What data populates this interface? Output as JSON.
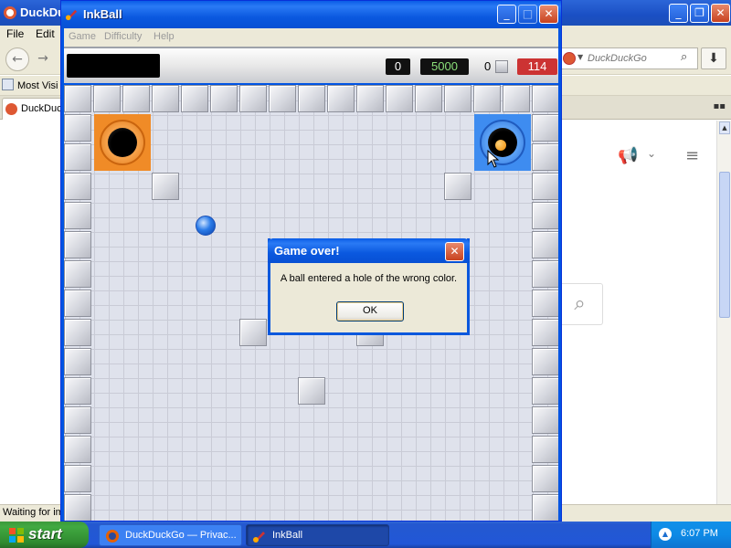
{
  "firefox": {
    "title": "DuckDuck",
    "menu": [
      "File",
      "Edit"
    ],
    "search_placeholder": "DuckDuckGo",
    "bookmarks_label": "Most Visi",
    "tab_label": "DuckDuck",
    "status": "Waiting for im"
  },
  "inkball": {
    "title": "InkBall",
    "menu": [
      "Game",
      "Difficulty",
      "Help"
    ],
    "ink_used": "0",
    "target_score": "5000",
    "balls_count": "0",
    "time_left": "114"
  },
  "dialog": {
    "title": "Game over!",
    "message": "A ball entered a hole of the wrong color.",
    "ok_label": "OK"
  },
  "taskbar": {
    "start_label": "start",
    "tasks": [
      {
        "label": "DuckDuckGo — Privac..."
      },
      {
        "label": "InkBall"
      }
    ],
    "clock": "6:07 PM"
  },
  "colors": {
    "hole_orange": "#f08b27",
    "hole_blue": "#3e8cf0",
    "time_badge": "#cc3333",
    "xp_title_blue": "#0a58df"
  },
  "icons": {
    "hole_icon": "hole-icon",
    "ball_icon": "ball-icon",
    "cursor_icon": "cursor-icon",
    "close_icon": "close-icon",
    "minimize_icon": "minimize-icon",
    "maximize_icon": "maximize-icon"
  }
}
